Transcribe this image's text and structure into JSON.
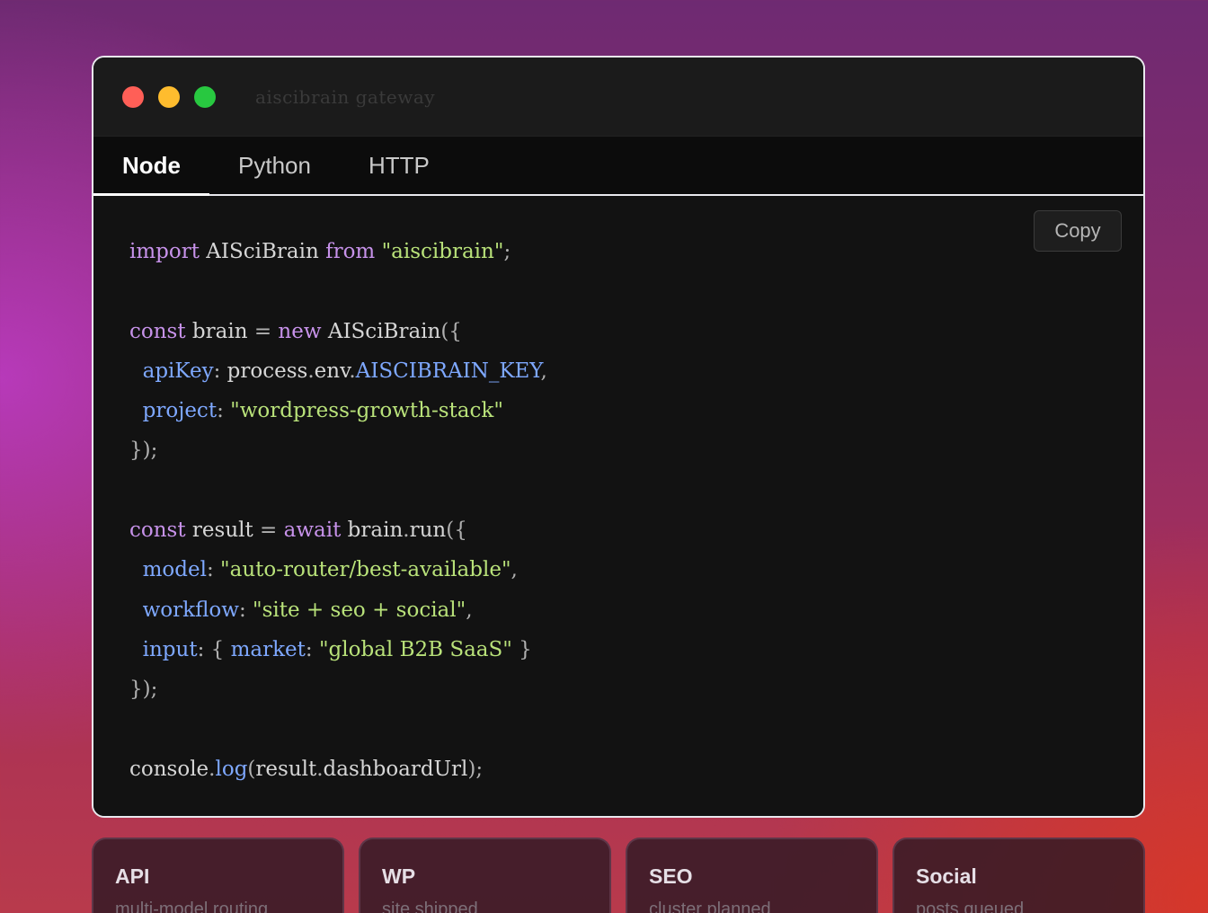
{
  "window": {
    "title": "aiscibrain gateway"
  },
  "tabs": [
    {
      "label": "Node",
      "active": true
    },
    {
      "label": "Python",
      "active": false
    },
    {
      "label": "HTTP",
      "active": false
    }
  ],
  "copy_label": "Copy",
  "code_lines": [
    [
      [
        "kw",
        "import"
      ],
      [
        "plain",
        " AISciBrain "
      ],
      [
        "kw",
        "from"
      ],
      [
        "plain",
        " "
      ],
      [
        "str",
        "\"aiscibrain\""
      ],
      [
        "punc",
        ";"
      ]
    ],
    [],
    [
      [
        "kw",
        "const"
      ],
      [
        "plain",
        " brain "
      ],
      [
        "punc",
        "="
      ],
      [
        "plain",
        " "
      ],
      [
        "kw",
        "new"
      ],
      [
        "plain",
        " AISciBrain"
      ],
      [
        "punc",
        "({"
      ]
    ],
    [
      [
        "plain",
        "  "
      ],
      [
        "prop",
        "apiKey"
      ],
      [
        "punc",
        ":"
      ],
      [
        "plain",
        " process"
      ],
      [
        "punc",
        "."
      ],
      [
        "plain",
        "env"
      ],
      [
        "punc",
        "."
      ],
      [
        "prop",
        "AISCIBRAIN_KEY"
      ],
      [
        "punc",
        ","
      ]
    ],
    [
      [
        "plain",
        "  "
      ],
      [
        "prop",
        "project"
      ],
      [
        "punc",
        ":"
      ],
      [
        "plain",
        " "
      ],
      [
        "str",
        "\"wordpress-growth-stack\""
      ]
    ],
    [
      [
        "punc",
        "});"
      ]
    ],
    [],
    [
      [
        "kw",
        "const"
      ],
      [
        "plain",
        " result "
      ],
      [
        "punc",
        "="
      ],
      [
        "plain",
        " "
      ],
      [
        "kw",
        "await"
      ],
      [
        "plain",
        " brain"
      ],
      [
        "punc",
        "."
      ],
      [
        "plain",
        "run"
      ],
      [
        "punc",
        "({"
      ]
    ],
    [
      [
        "plain",
        "  "
      ],
      [
        "prop",
        "model"
      ],
      [
        "punc",
        ":"
      ],
      [
        "plain",
        " "
      ],
      [
        "str",
        "\"auto-router/best-available\""
      ],
      [
        "punc",
        ","
      ]
    ],
    [
      [
        "plain",
        "  "
      ],
      [
        "prop",
        "workflow"
      ],
      [
        "punc",
        ":"
      ],
      [
        "plain",
        " "
      ],
      [
        "str",
        "\"site + seo + social\""
      ],
      [
        "punc",
        ","
      ]
    ],
    [
      [
        "plain",
        "  "
      ],
      [
        "prop",
        "input"
      ],
      [
        "punc",
        ":"
      ],
      [
        "plain",
        " "
      ],
      [
        "punc",
        "{"
      ],
      [
        "plain",
        " "
      ],
      [
        "prop",
        "market"
      ],
      [
        "punc",
        ":"
      ],
      [
        "plain",
        " "
      ],
      [
        "str",
        "\"global B2B SaaS\""
      ],
      [
        "plain",
        " "
      ],
      [
        "punc",
        "}"
      ]
    ],
    [
      [
        "punc",
        "});"
      ]
    ],
    [],
    [
      [
        "plain",
        "console"
      ],
      [
        "punc",
        "."
      ],
      [
        "prop",
        "log"
      ],
      [
        "punc",
        "("
      ],
      [
        "plain",
        "result"
      ],
      [
        "punc",
        "."
      ],
      [
        "plain",
        "dashboardUrl"
      ],
      [
        "punc",
        ");"
      ]
    ]
  ],
  "cards": [
    {
      "title": "API",
      "subtitle": "multi-model routing"
    },
    {
      "title": "WP",
      "subtitle": "site shipped"
    },
    {
      "title": "SEO",
      "subtitle": "cluster planned"
    },
    {
      "title": "Social",
      "subtitle": "posts queued"
    }
  ]
}
